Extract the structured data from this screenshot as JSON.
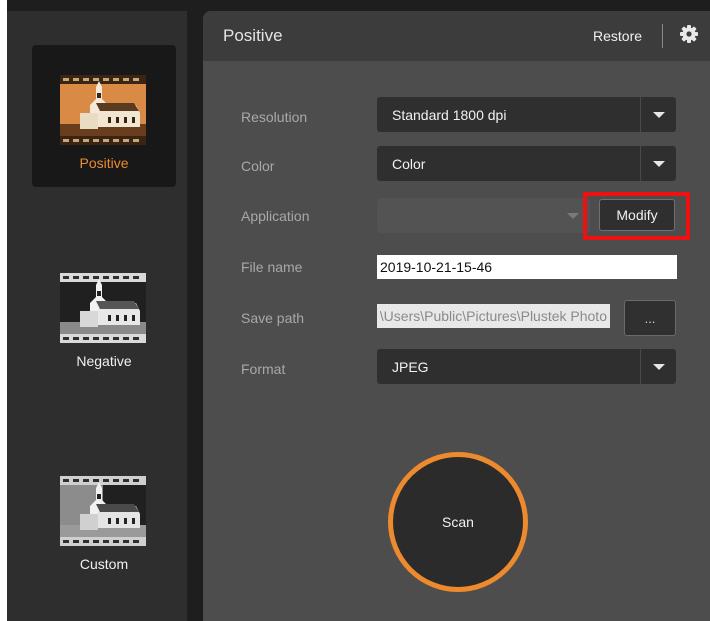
{
  "sidebar": {
    "modes": [
      {
        "label": "Positive",
        "active": true,
        "icon": "positive-film-icon"
      },
      {
        "label": "Negative",
        "active": false,
        "icon": "negative-film-icon"
      },
      {
        "label": "Custom",
        "active": false,
        "icon": "custom-film-icon"
      }
    ]
  },
  "header": {
    "title": "Positive",
    "restore_label": "Restore",
    "settings_icon": "gear-icon"
  },
  "form": {
    "resolution": {
      "label": "Resolution",
      "value": "Standard 1800 dpi"
    },
    "color": {
      "label": "Color",
      "value": "Color"
    },
    "application": {
      "label": "Application",
      "value": "",
      "modify_label": "Modify"
    },
    "file_name": {
      "label": "File name",
      "value": "2019-10-21-15-46"
    },
    "save_path": {
      "label": "Save path",
      "value": "C:\\Users\\Public\\Pictures\\Plustek Photo",
      "browse_label": "..."
    },
    "format": {
      "label": "Format",
      "value": "JPEG"
    }
  },
  "scan": {
    "label": "Scan"
  },
  "colors": {
    "accent": "#ee8a2e",
    "highlight": "#ee1111",
    "panel": "#4d4d4d",
    "sidebar": "#2e2e2e"
  }
}
